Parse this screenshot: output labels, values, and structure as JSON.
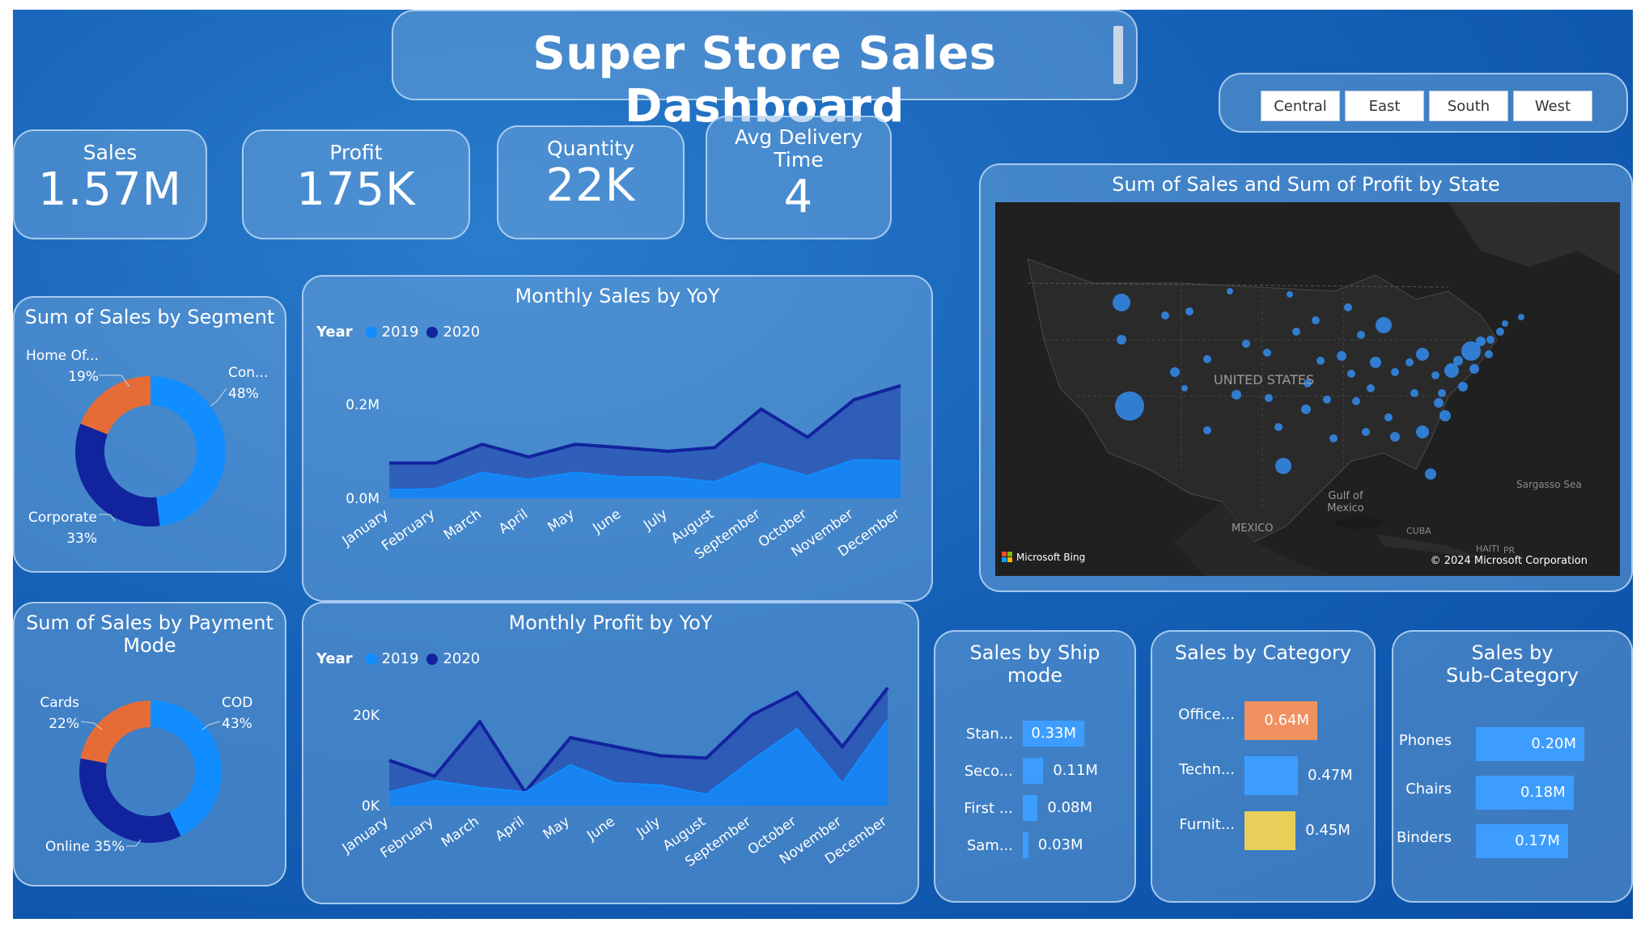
{
  "header": {
    "title": "Super Store Sales Dashboard"
  },
  "kpis": [
    {
      "label": "Sales",
      "value": "1.57M"
    },
    {
      "label": "Profit",
      "value": "175K"
    },
    {
      "label": "Quantity",
      "value": "22K"
    },
    {
      "label_line1": "Avg Delivery",
      "label_line2": "Time",
      "value": "4"
    }
  ],
  "region_slicer": {
    "options": [
      "Central",
      "East",
      "South",
      "West"
    ]
  },
  "segment_donut": {
    "title": "Sum of Sales by Segment",
    "labels": [
      {
        "name": "Con...",
        "pct": "48%"
      },
      {
        "name": "Corporate",
        "pct": "33%"
      },
      {
        "name": "Home Of...",
        "pct": "19%"
      }
    ],
    "chart_data": {
      "type": "pie",
      "categories": [
        "Consumer",
        "Corporate",
        "Home Office"
      ],
      "values": [
        48,
        33,
        19
      ],
      "colors": [
        "#118dff",
        "#12239e",
        "#e66c37"
      ]
    }
  },
  "payment_donut": {
    "title_line1": "Sum of Sales by Payment",
    "title_line2": "Mode",
    "labels": [
      {
        "name": "COD",
        "pct": "43%"
      },
      {
        "name": "Online 35%",
        "pct": ""
      },
      {
        "name": "Cards",
        "pct": "22%"
      }
    ],
    "chart_data": {
      "type": "pie",
      "categories": [
        "COD",
        "Online",
        "Cards"
      ],
      "values": [
        43,
        35,
        22
      ],
      "colors": [
        "#118dff",
        "#12239e",
        "#e66c37"
      ]
    }
  },
  "monthly_sales": {
    "title": "Monthly Sales by YoY",
    "legend_title": "Year",
    "legend": [
      "2019",
      "2020"
    ],
    "y_ticks": [
      "0.2M",
      "0.0M"
    ],
    "chart_data": {
      "type": "area",
      "categories": [
        "January",
        "February",
        "March",
        "April",
        "May",
        "June",
        "July",
        "August",
        "September",
        "October",
        "November",
        "December"
      ],
      "series": [
        {
          "name": "2019",
          "values": [
            0.018,
            0.02,
            0.055,
            0.04,
            0.055,
            0.045,
            0.045,
            0.035,
            0.075,
            0.048,
            0.082,
            0.08
          ]
        },
        {
          "name": "2020",
          "values": [
            0.075,
            0.075,
            0.115,
            0.088,
            0.115,
            0.108,
            0.1,
            0.108,
            0.19,
            0.13,
            0.21,
            0.24
          ]
        }
      ],
      "ylim": [
        0,
        0.3
      ],
      "colors": [
        "#118dff",
        "#12239e"
      ]
    }
  },
  "monthly_profit": {
    "title": "Monthly Profit by YoY",
    "legend_title": "Year",
    "legend": [
      "2019",
      "2020"
    ],
    "y_ticks": [
      "20K",
      "0K"
    ],
    "chart_data": {
      "type": "area",
      "categories": [
        "January",
        "February",
        "March",
        "April",
        "May",
        "June",
        "July",
        "August",
        "September",
        "October",
        "November",
        "December"
      ],
      "series": [
        {
          "name": "2019",
          "values": [
            3000,
            5500,
            4000,
            3000,
            9000,
            5000,
            4500,
            2500,
            10000,
            17000,
            5000,
            19000
          ]
        },
        {
          "name": "2020",
          "values": [
            10000,
            6500,
            18500,
            3000,
            15000,
            13000,
            11000,
            10500,
            20000,
            25000,
            13000,
            26000
          ]
        }
      ],
      "ylim": [
        0,
        30000
      ],
      "colors": [
        "#118dff",
        "#12239e"
      ]
    }
  },
  "map": {
    "title": "Sum of Sales and Sum of Profit by State",
    "labels": {
      "country": "UNITED STATES",
      "gulf": "Gulf of Mexico",
      "mexico": "MEXICO",
      "sargasso": "Sargasso Sea",
      "cuba": "CUBA",
      "haiti": "HAITI",
      "pr": "PR"
    },
    "attribution": "© 2024 Microsoft Corporation",
    "provider": "Microsoft Bing"
  },
  "ship_mode": {
    "title_line1": "Sales by Ship",
    "title_line2": "mode",
    "chart_data": {
      "type": "bar",
      "categories": [
        "Stan...",
        "Seco...",
        "First ...",
        "Sam..."
      ],
      "values": [
        0.33,
        0.11,
        0.08,
        0.03
      ],
      "labels": [
        "0.33M",
        "0.11M",
        "0.08M",
        "0.03M"
      ],
      "color": "#3d9dff"
    }
  },
  "category": {
    "title": "Sales by Category",
    "chart_data": {
      "type": "bar",
      "categories": [
        "Office...",
        "Techn...",
        "Furnit..."
      ],
      "values": [
        0.64,
        0.47,
        0.45
      ],
      "labels": [
        "0.64M",
        "0.47M",
        "0.45M"
      ],
      "colors": [
        "#f0915f",
        "#3d9dff",
        "#e8cf5a"
      ]
    }
  },
  "sub_category": {
    "title_line1": "Sales by",
    "title_line2": "Sub-Category",
    "chart_data": {
      "type": "bar",
      "categories": [
        "Phones",
        "Chairs",
        "Binders"
      ],
      "values": [
        0.2,
        0.18,
        0.17
      ],
      "labels": [
        "0.20M",
        "0.18M",
        "0.17M"
      ],
      "color": "#3d9dff"
    }
  }
}
